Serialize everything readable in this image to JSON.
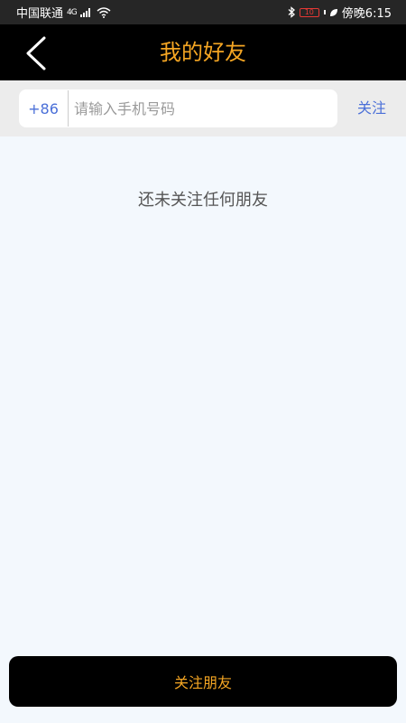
{
  "status_bar": {
    "carrier": "中国联通",
    "network": "4G",
    "battery": "10",
    "time": "傍晚6:15"
  },
  "nav": {
    "title": "我的好友"
  },
  "search": {
    "country_code": "+86",
    "placeholder": "请输入手机号码",
    "follow_label": "关注"
  },
  "main": {
    "empty_message": "还未关注任何朋友"
  },
  "footer": {
    "follow_friends_label": "关注朋友"
  },
  "colors": {
    "accent": "#f5a623",
    "link": "#4a6fd8",
    "nav_background": "#000000",
    "page_background": "#f3f8fd"
  }
}
